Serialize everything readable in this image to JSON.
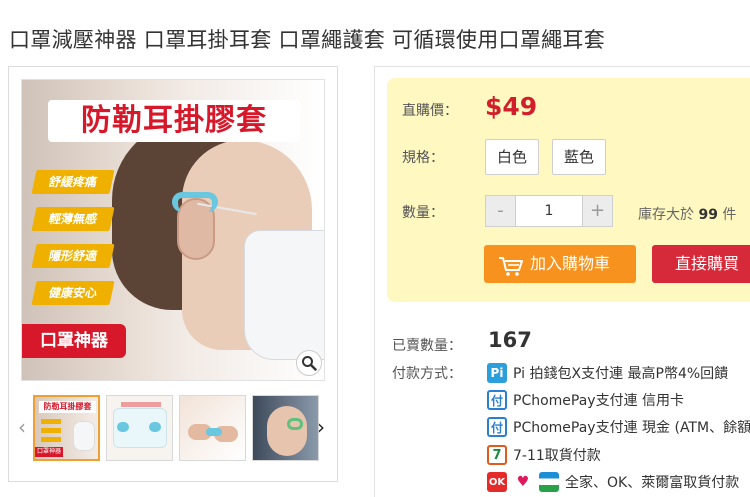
{
  "product": {
    "title": "口罩減壓神器 口罩耳掛耳套 口罩繩護套 可循環使用口罩繩耳套"
  },
  "gallery": {
    "main_image": {
      "headline": "防勒耳掛膠套",
      "badges": [
        "舒緩疼痛",
        "輕薄無感",
        "隱形舒適",
        "健康安心"
      ],
      "ribbon": "口罩神器"
    },
    "thumbnails": [
      {
        "caption": "防勒耳掛膠套",
        "ribbon": "口罩神器",
        "active": true
      },
      {
        "caption": "",
        "active": false
      },
      {
        "caption": "",
        "active": false
      },
      {
        "caption": "",
        "active": false
      }
    ]
  },
  "purchase": {
    "price_label": "直購價：",
    "price_value": "$49",
    "spec_label": "規格：",
    "spec_options": [
      "白色",
      "藍色"
    ],
    "qty_label": "數量：",
    "qty_minus": "-",
    "qty_value": "1",
    "qty_plus": "+",
    "stock_prefix": "庫存大於",
    "stock_value": "99",
    "stock_suffix": "件",
    "add_to_cart": "加入購物車",
    "buy_now": "直接購買"
  },
  "sales": {
    "sold_label": "已賣數量：",
    "sold_value": "167",
    "payment_label": "付款方式：",
    "payment_methods": [
      {
        "icon": "pi-wallet-icon",
        "text": "Pi 拍錢包X支付連   最高P幣4%回饋"
      },
      {
        "icon": "pchomepay-icon",
        "text": "PChomePay支付連 信用卡"
      },
      {
        "icon": "pchomepay-icon",
        "text": "PChomePay支付連 現金 (ATM、餘額)"
      },
      {
        "icon": "seven-eleven-icon",
        "text": "7-11取貨付款"
      },
      {
        "icon": "family-mart-icon",
        "text": "全家、OK、萊爾富取貨付款"
      }
    ]
  },
  "colors": {
    "price": "#d21e2b",
    "cart_button": "#f7921e",
    "buy_button": "#d62a3a",
    "panel_bg": "#fff8c0",
    "badge": "#f0b000"
  }
}
